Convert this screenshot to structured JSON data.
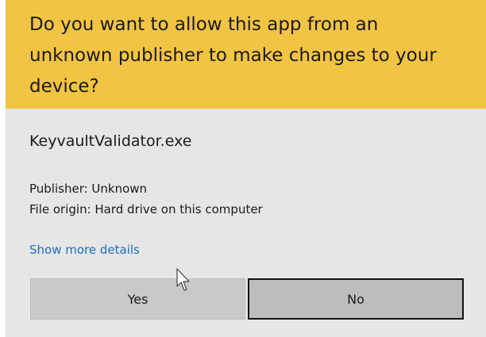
{
  "dialog": {
    "title": "Do you want to allow this app from an\nunknown publisher to make changes to your\ndevice?",
    "app_name": "KeyvaultValidator.exe",
    "publisher": "Publisher: Unknown",
    "file_origin": "File origin: Hard drive on this computer",
    "details_link": "Show more details",
    "buttons": {
      "yes": "Yes",
      "no": "No"
    }
  },
  "colors": {
    "header_bg": "#f2c443",
    "body_bg": "#e6e6e6",
    "link": "#1a6cc0"
  },
  "icons": {
    "cursor": "mouse-pointer-icon"
  }
}
